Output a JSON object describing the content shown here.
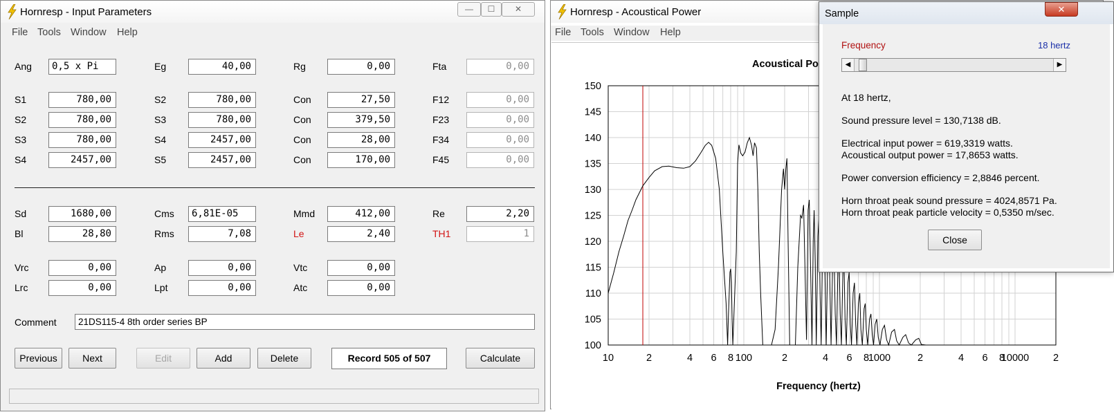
{
  "input_window": {
    "title": "Hornresp - Input Parameters",
    "menu": [
      "File",
      "Tools",
      "Window",
      "Help"
    ],
    "caption_buttons": [
      "—",
      "☐",
      "✕"
    ],
    "params": [
      {
        "label": "Ang",
        "value": "0,5 x Pi",
        "align": "left"
      },
      {
        "label": "Eg",
        "value": "40,00"
      },
      {
        "label": "Rg",
        "value": "0,00"
      },
      {
        "label": "Fta",
        "value": "0,00",
        "disabled": true
      },
      {
        "label": "S1",
        "value": "780,00"
      },
      {
        "label": "S2",
        "value": "780,00"
      },
      {
        "label": "Con",
        "value": "27,50"
      },
      {
        "label": "F12",
        "value": "0,00",
        "disabled": true
      },
      {
        "label": "S2",
        "value": "780,00"
      },
      {
        "label": "S3",
        "value": "780,00"
      },
      {
        "label": "Con",
        "value": "379,50"
      },
      {
        "label": "F23",
        "value": "0,00",
        "disabled": true
      },
      {
        "label": "S3",
        "value": "780,00"
      },
      {
        "label": "S4",
        "value": "2457,00"
      },
      {
        "label": "Con",
        "value": "28,00"
      },
      {
        "label": "F34",
        "value": "0,00",
        "disabled": true
      },
      {
        "label": "S4",
        "value": "2457,00"
      },
      {
        "label": "S5",
        "value": "2457,00"
      },
      {
        "label": "Con",
        "value": "170,00"
      },
      {
        "label": "F45",
        "value": "0,00",
        "disabled": true
      },
      {
        "label": "Sd",
        "value": "1680,00"
      },
      {
        "label": "Cms",
        "value": "6,81E-05",
        "align": "left"
      },
      {
        "label": "Mmd",
        "value": "412,00"
      },
      {
        "label": "Re",
        "value": "2,20"
      },
      {
        "label": "Bl",
        "value": "28,80"
      },
      {
        "label": "Rms",
        "value": "7,08"
      },
      {
        "label": "Le",
        "value": "2,40",
        "red": true
      },
      {
        "label": "TH1",
        "value": "1",
        "red": true,
        "disabled": true
      },
      {
        "label": "Vrc",
        "value": "0,00"
      },
      {
        "label": "Ap",
        "value": "0,00"
      },
      {
        "label": "Vtc",
        "value": "0,00"
      },
      {
        "label": "Lrc",
        "value": "0,00"
      },
      {
        "label": "Lpt",
        "value": "0,00"
      },
      {
        "label": "Atc",
        "value": "0,00"
      }
    ],
    "comment_label": "Comment",
    "comment_value": "21DS115-4 8th order series BP",
    "buttons": {
      "previous": "Previous",
      "next": "Next",
      "edit": "Edit",
      "add": "Add",
      "delete": "Delete",
      "record": "Record 505 of 507",
      "calculate": "Calculate"
    }
  },
  "power_window": {
    "title": "Hornresp - Acoustical Power",
    "menu": [
      "File",
      "Tools",
      "Window",
      "Help"
    ],
    "chart_title_visible": "Acoustical Pov"
  },
  "sample_dialog": {
    "title": "Sample",
    "close_x": "✕",
    "frequency_label": "Frequency",
    "frequency_value": "18 hertz",
    "slider_position": 0.02,
    "lines": [
      "At 18 hertz,",
      "Sound pressure level = 130,7138 dB.",
      "Electrical input power = 619,3319 watts.",
      "Acoustical output power = 17,8653 watts.",
      "Power conversion efficiency = 2,8846 percent.",
      "Horn throat peak sound pressure = 4024,8571 Pa.",
      "Horn throat peak particle velocity = 0,5350 m/sec."
    ],
    "close_button": "Close"
  },
  "chart_data": {
    "type": "line",
    "title": "Acoustical Pov",
    "xlabel": "Frequency (hertz)",
    "ylabel": "",
    "x_scale": "log",
    "xlim": [
      10,
      20000
    ],
    "ylim": [
      100,
      150
    ],
    "grid": true,
    "y_ticks": [
      100,
      105,
      110,
      115,
      120,
      125,
      130,
      135,
      140,
      145,
      150
    ],
    "x_tick_labels": [
      {
        "x": 10,
        "label": "10"
      },
      {
        "x": 20,
        "label": "2"
      },
      {
        "x": 40,
        "label": "4"
      },
      {
        "x": 60,
        "label": "6"
      },
      {
        "x": 80,
        "label": "8"
      },
      {
        "x": 100,
        "label": "100"
      },
      {
        "x": 200,
        "label": "2"
      },
      {
        "x": 400,
        "label": "4"
      },
      {
        "x": 600,
        "label": "6"
      },
      {
        "x": 800,
        "label": "8"
      },
      {
        "x": 1000,
        "label": "1000"
      },
      {
        "x": 2000,
        "label": "2"
      },
      {
        "x": 4000,
        "label": "4"
      },
      {
        "x": 6000,
        "label": "6"
      },
      {
        "x": 8000,
        "label": "8"
      },
      {
        "x": 10000,
        "label": "10000"
      },
      {
        "x": 20000,
        "label": "2"
      }
    ],
    "marker_frequency": 18,
    "marker_color": "#c00000",
    "series": [
      {
        "points": [
          [
            10,
            110
          ],
          [
            11,
            114
          ],
          [
            12,
            118
          ],
          [
            13,
            121
          ],
          [
            14,
            124
          ],
          [
            15,
            126
          ],
          [
            16,
            128
          ],
          [
            18,
            130.7
          ],
          [
            20,
            132.3
          ],
          [
            22,
            133.6
          ],
          [
            25,
            134.4
          ],
          [
            28,
            134.5
          ],
          [
            32,
            134.2
          ],
          [
            36,
            134.1
          ],
          [
            40,
            134.4
          ],
          [
            44,
            135.5
          ],
          [
            48,
            137
          ],
          [
            52,
            138.5
          ],
          [
            55,
            139.1
          ],
          [
            58,
            138.5
          ],
          [
            62,
            136
          ],
          [
            66,
            130
          ],
          [
            70,
            118
          ],
          [
            74,
            108
          ],
          [
            76,
            100
          ],
          [
            77,
            106
          ],
          [
            78,
            110
          ],
          [
            79,
            114
          ],
          [
            80,
            114.7
          ],
          [
            81,
            112
          ],
          [
            82,
            105
          ],
          [
            83,
            100
          ],
          [
            88,
            118
          ],
          [
            90,
            135
          ],
          [
            92,
            138.6
          ],
          [
            95,
            137
          ],
          [
            98,
            136.5
          ],
          [
            102,
            137.2
          ],
          [
            106,
            139
          ],
          [
            110,
            140
          ],
          [
            114,
            138.5
          ],
          [
            117,
            136.5
          ],
          [
            120,
            139
          ],
          [
            124,
            138
          ],
          [
            127,
            130
          ],
          [
            130,
            118
          ],
          [
            133,
            110
          ],
          [
            138,
            100
          ],
          [
            145,
            100
          ],
          [
            160,
            100
          ],
          [
            170,
            103
          ],
          [
            180,
            115
          ],
          [
            190,
            130
          ],
          [
            196,
            134
          ],
          [
            200,
            130
          ],
          [
            204,
            134
          ],
          [
            208,
            136
          ],
          [
            212,
            120
          ],
          [
            218,
            100
          ],
          [
            240,
            100
          ],
          [
            250,
            115
          ],
          [
            262,
            125
          ],
          [
            268,
            124.5
          ],
          [
            276,
            127
          ],
          [
            282,
            116
          ],
          [
            290,
            101
          ],
          [
            298,
            126
          ],
          [
            304,
            128
          ],
          [
            312,
            112
          ],
          [
            318,
            100
          ],
          [
            325,
            120
          ],
          [
            330,
            126
          ],
          [
            336,
            116
          ],
          [
            342,
            100
          ],
          [
            352,
            121
          ],
          [
            358,
            124.5
          ],
          [
            365,
            110
          ],
          [
            372,
            100
          ],
          [
            382,
            122
          ],
          [
            390,
            124
          ],
          [
            398,
            111
          ],
          [
            405,
            100
          ],
          [
            416,
            118
          ],
          [
            424,
            122
          ],
          [
            432,
            110
          ],
          [
            440,
            100
          ],
          [
            452,
            116
          ],
          [
            462,
            118
          ],
          [
            472,
            106
          ],
          [
            482,
            100
          ],
          [
            494,
            115
          ],
          [
            504,
            117
          ],
          [
            514,
            106
          ],
          [
            524,
            100
          ],
          [
            538,
            114
          ],
          [
            548,
            116
          ],
          [
            558,
            105
          ],
          [
            570,
            100
          ],
          [
            585,
            112
          ],
          [
            598,
            114
          ],
          [
            610,
            104
          ],
          [
            622,
            100
          ],
          [
            640,
            110
          ],
          [
            654,
            112
          ],
          [
            668,
            104
          ],
          [
            682,
            100
          ],
          [
            700,
            108
          ],
          [
            716,
            110
          ],
          [
            730,
            103
          ],
          [
            748,
            100
          ],
          [
            770,
            107
          ],
          [
            786,
            108
          ],
          [
            800,
            103
          ],
          [
            820,
            100
          ],
          [
            845,
            105
          ],
          [
            865,
            106
          ],
          [
            885,
            102
          ],
          [
            905,
            100
          ],
          [
            930,
            104
          ],
          [
            955,
            105
          ],
          [
            980,
            101.5
          ],
          [
            1010,
            100
          ],
          [
            1050,
            103
          ],
          [
            1090,
            103.8
          ],
          [
            1130,
            101
          ],
          [
            1170,
            100
          ],
          [
            1230,
            102.5
          ],
          [
            1290,
            103
          ],
          [
            1340,
            100.8
          ],
          [
            1400,
            100
          ],
          [
            1490,
            101.5
          ],
          [
            1560,
            102
          ],
          [
            1640,
            100.4
          ],
          [
            1720,
            100
          ],
          [
            1850,
            101
          ],
          [
            1950,
            101.3
          ],
          [
            2040,
            100.1
          ],
          [
            2200,
            100
          ],
          [
            20000,
            100
          ]
        ]
      }
    ]
  }
}
